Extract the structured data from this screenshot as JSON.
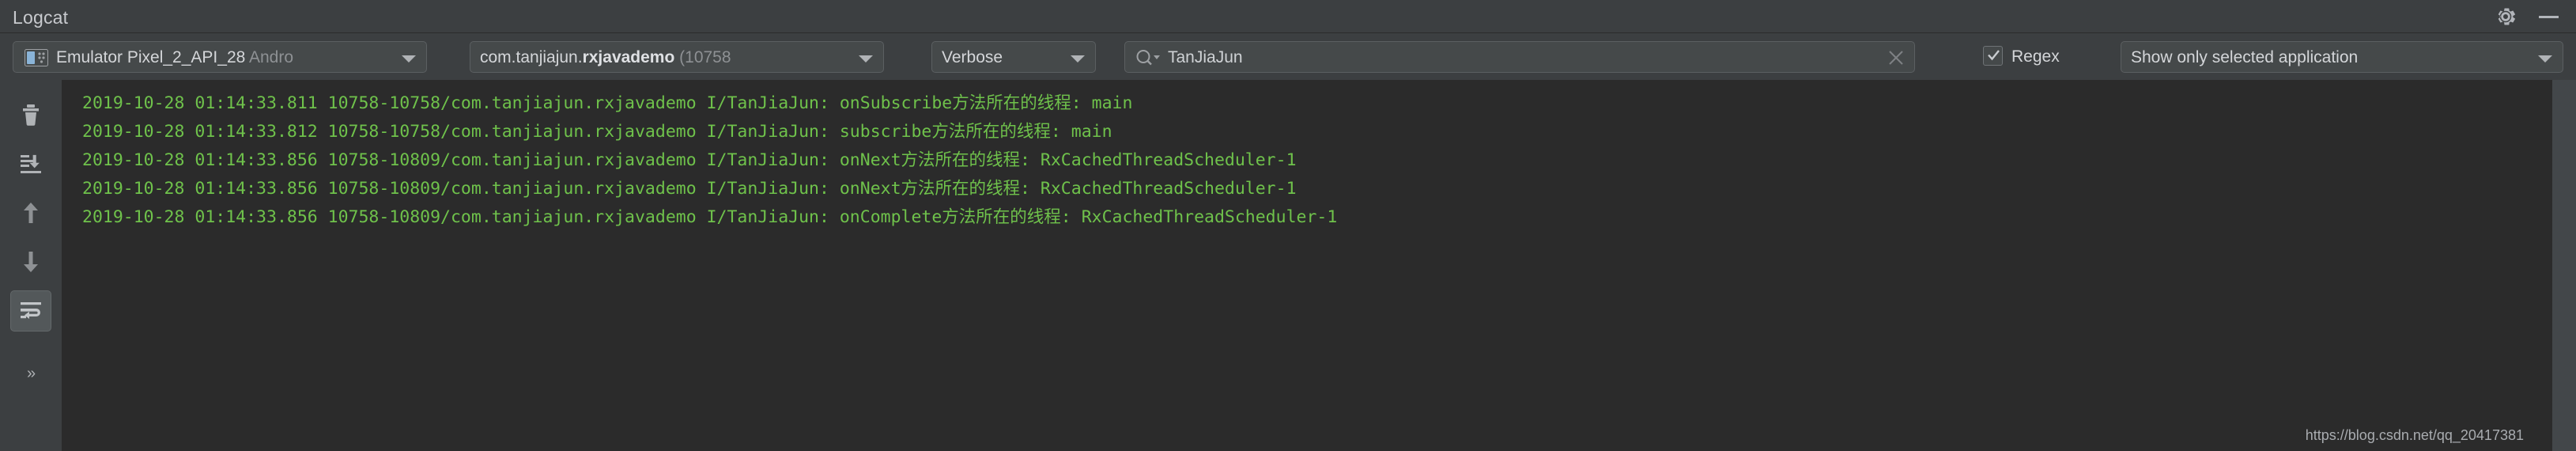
{
  "window": {
    "title": "Logcat",
    "gear_icon": "gear-icon",
    "minimize_icon": "minimize-icon"
  },
  "toolbar": {
    "device": {
      "icon": "emulator-device-icon",
      "name": "Emulator Pixel_2_API_28 ",
      "name_dim": "Andro",
      "caret_icon": "chevron-down-icon"
    },
    "process": {
      "package_prefix": "com.tanjiajun.",
      "package_name": "rxjavademo",
      "pid": " (10758",
      "caret_icon": "chevron-down-icon"
    },
    "level": {
      "value": "Verbose",
      "caret_icon": "chevron-down-icon"
    },
    "search": {
      "icon": "search-icon",
      "value": "TanJiaJun",
      "placeholder": "",
      "clear_icon": "close-icon"
    },
    "regex": {
      "label": "Regex",
      "checked": true,
      "check_icon": "checkmark-icon"
    },
    "filter": {
      "value": "Show only selected application",
      "caret_icon": "chevron-down-icon"
    }
  },
  "rail": {
    "items": [
      {
        "name": "clear-logcat-button",
        "icon": "trash-icon",
        "active": false
      },
      {
        "name": "scroll-to-end-button",
        "icon": "scroll-to-end-icon",
        "active": false
      },
      {
        "name": "previous-occurrence-button",
        "icon": "arrow-up-icon",
        "active": false
      },
      {
        "name": "next-occurrence-button",
        "icon": "arrow-down-icon",
        "active": false
      },
      {
        "name": "soft-wrap-button",
        "icon": "soft-wrap-icon",
        "active": true
      },
      {
        "name": "more-options-button",
        "icon": "chevron-double-right-icon",
        "active": false
      }
    ],
    "more_label": "»"
  },
  "console": {
    "lines": [
      "2019-10-28 01:14:33.811 10758-10758/com.tanjiajun.rxjavademo I/TanJiaJun: onSubscribe方法所在的线程: main",
      "2019-10-28 01:14:33.812 10758-10758/com.tanjiajun.rxjavademo I/TanJiaJun: subscribe方法所在的线程: main",
      "2019-10-28 01:14:33.856 10758-10809/com.tanjiajun.rxjavademo I/TanJiaJun: onNext方法所在的线程: RxCachedThreadScheduler-1",
      "2019-10-28 01:14:33.856 10758-10809/com.tanjiajun.rxjavademo I/TanJiaJun: onNext方法所在的线程: RxCachedThreadScheduler-1",
      "2019-10-28 01:14:33.856 10758-10809/com.tanjiajun.rxjavademo I/TanJiaJun: onComplete方法所在的线程: RxCachedThreadScheduler-1"
    ],
    "text_color": "#6fc24b",
    "background_color": "#2b2b2b"
  },
  "watermark": {
    "text": "https://blog.csdn.net/qq_20417381"
  }
}
